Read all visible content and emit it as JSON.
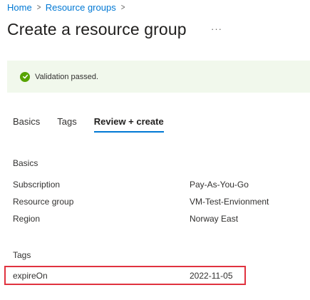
{
  "breadcrumb": {
    "items": [
      "Home",
      "Resource groups"
    ],
    "separator": ">"
  },
  "header": {
    "title": "Create a resource group",
    "more_label": "···"
  },
  "validation": {
    "message": "Validation passed.",
    "icon": "check-circle-icon",
    "color": "#57a300"
  },
  "tabs": [
    {
      "label": "Basics"
    },
    {
      "label": "Tags"
    },
    {
      "label": "Review + create",
      "active": true
    }
  ],
  "basics": {
    "heading": "Basics",
    "rows": [
      {
        "label": "Subscription",
        "value": "Pay-As-You-Go"
      },
      {
        "label": "Resource group",
        "value": "VM-Test-Envionment"
      },
      {
        "label": "Region",
        "value": "Norway East"
      }
    ]
  },
  "tags": {
    "heading": "Tags",
    "rows": [
      {
        "label": "expireOn",
        "value": "2022-11-05"
      }
    ]
  },
  "colors": {
    "accent": "#0078d4",
    "highlight": "#e0323f",
    "banner_bg": "#f1f8ec"
  }
}
